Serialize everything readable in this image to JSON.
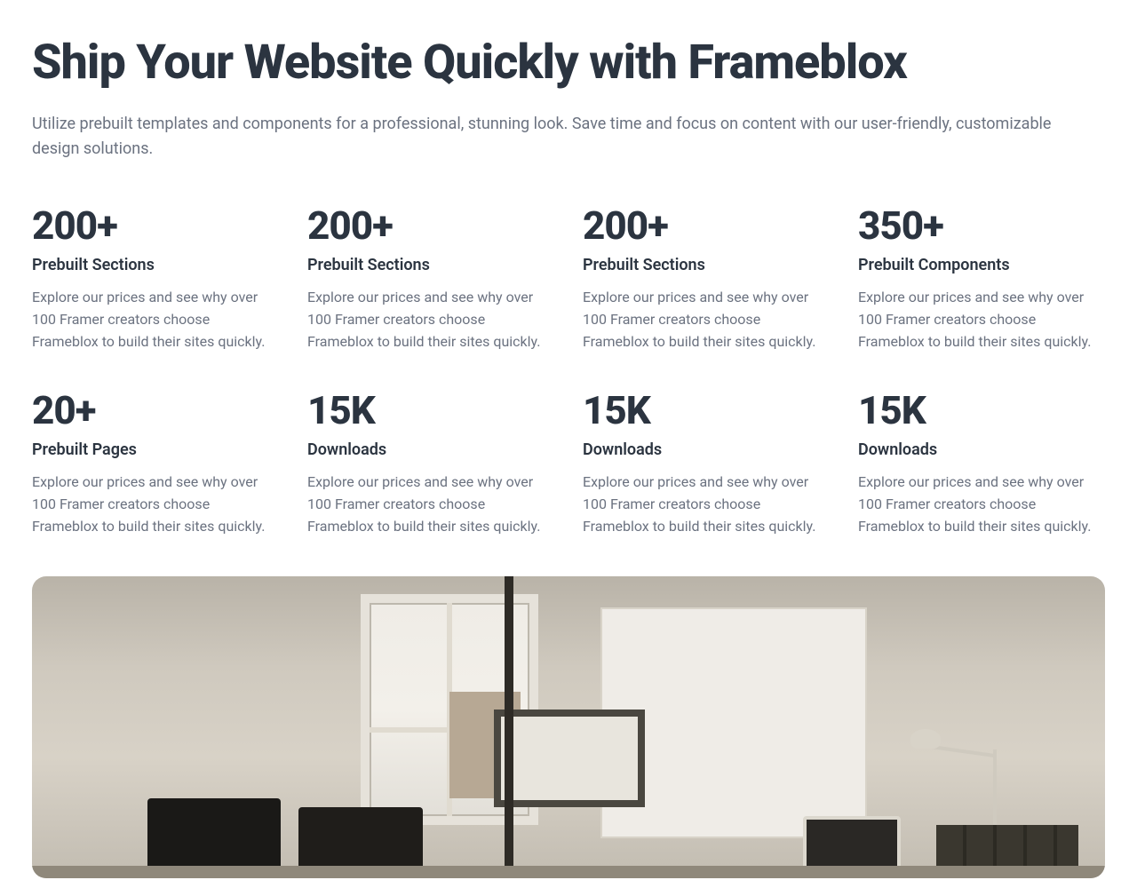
{
  "hero": {
    "title": "Ship Your Website Quickly with Frameblox",
    "subtitle": "Utilize prebuilt templates and components for a professional, stunning look. Save time and focus on content with our user-friendly, customizable design solutions."
  },
  "stats": [
    {
      "value": "200+",
      "label": "Prebuilt Sections",
      "desc": "Explore our prices and see why over 100 Framer creators choose Frameblox to build their sites quickly."
    },
    {
      "value": "200+",
      "label": "Prebuilt Sections",
      "desc": "Explore our prices and see why over 100 Framer creators choose Frameblox to build their sites quickly."
    },
    {
      "value": "200+",
      "label": "Prebuilt Sections",
      "desc": "Explore our prices and see why over 100 Framer creators choose Frameblox to build their sites quickly."
    },
    {
      "value": "350+",
      "label": "Prebuilt Components",
      "desc": "Explore our prices and see why over 100 Framer creators choose Frameblox to build their sites quickly."
    },
    {
      "value": "20+",
      "label": "Prebuilt Pages",
      "desc": "Explore our prices and see why over 100 Framer creators choose Frameblox to build their sites quickly."
    },
    {
      "value": "15K",
      "label": "Downloads",
      "desc": "Explore our prices and see why over 100 Framer creators choose Frameblox to build their sites quickly."
    },
    {
      "value": "15K",
      "label": "Downloads",
      "desc": "Explore our prices and see why over 100 Framer creators choose Frameblox to build their sites quickly."
    },
    {
      "value": "15K",
      "label": "Downloads",
      "desc": "Explore our prices and see why over 100 Framer creators choose Frameblox to build their sites quickly."
    }
  ]
}
